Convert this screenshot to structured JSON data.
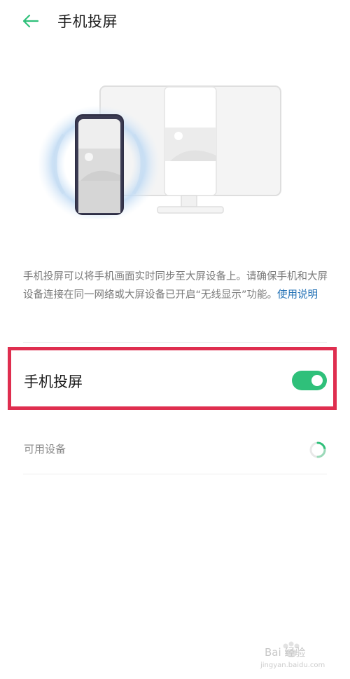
{
  "header": {
    "back_icon": "arrow-left-icon",
    "title": "手机投屏"
  },
  "colors": {
    "accent_green": "#2fc07a",
    "link_blue": "#1f6fb5",
    "highlight_red": "#df2e4f"
  },
  "description": {
    "text": "手机投屏可以将手机画面实时同步至大屏设备上。请确保手机和大屏设备连接在同一网络或大屏设备已开启“无线显示”功能。",
    "help_link": "使用说明"
  },
  "cast_setting": {
    "label": "手机投屏",
    "enabled": true
  },
  "available_devices": {
    "label": "可用设备",
    "status_icon": "loading-spinner-icon"
  },
  "watermark": {
    "text": "Bai 经验",
    "sub": "jingyan.baidu.com"
  }
}
